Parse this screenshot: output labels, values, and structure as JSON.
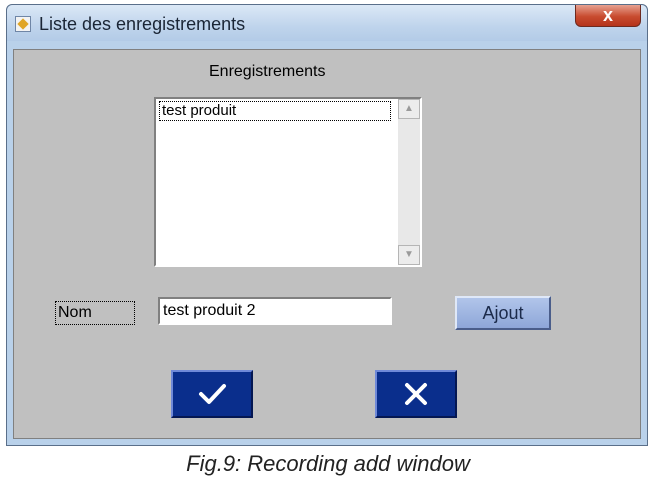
{
  "window": {
    "title": "Liste des enregistrements",
    "close_label": "x"
  },
  "list": {
    "label": "Enregistrements",
    "items": [
      "test produit"
    ]
  },
  "form": {
    "nom_label": "Nom",
    "nom_value": "test produit 2",
    "ajout_label": "Ajout"
  },
  "icons": {
    "ok": "checkmark-icon",
    "cancel": "x-icon",
    "scroll_up": "arrow-up-icon",
    "scroll_down": "arrow-down-icon"
  },
  "caption": "Fig.9: Recording add window",
  "colors": {
    "window_frame": "#b9d1ea",
    "client": "#c0c0c0",
    "action_button": "#0a2e8c",
    "ajout_button": "#8ea6d8",
    "close_button": "#c84b2f"
  }
}
